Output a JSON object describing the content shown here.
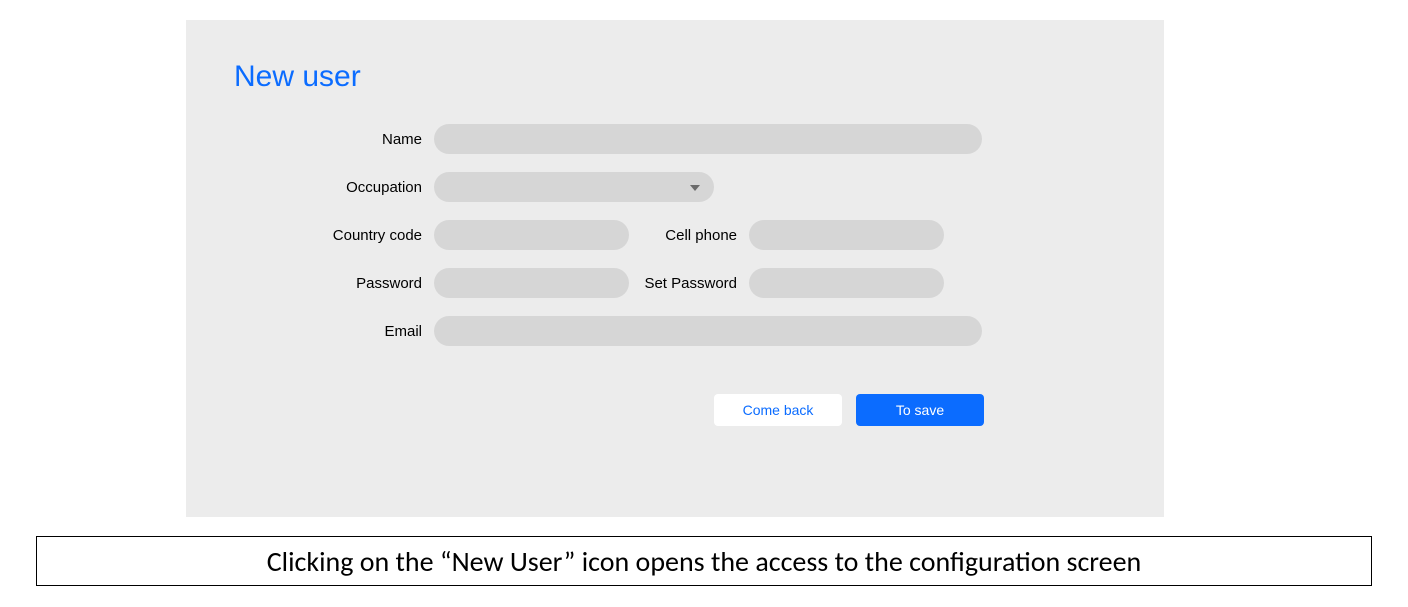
{
  "panel": {
    "title": "New user",
    "labels": {
      "name": "Name",
      "occupation": "Occupation",
      "country_code": "Country code",
      "cell_phone": "Cell phone",
      "password": "Password",
      "set_password": "Set Password",
      "email": "Email"
    },
    "values": {
      "name": "",
      "occupation": "",
      "country_code": "",
      "cell_phone": "",
      "password": "",
      "set_password": "",
      "email": ""
    },
    "buttons": {
      "back": "Come back",
      "save": "To save"
    }
  },
  "caption": "Clicking on the “New User” icon opens the access to the configuration screen"
}
